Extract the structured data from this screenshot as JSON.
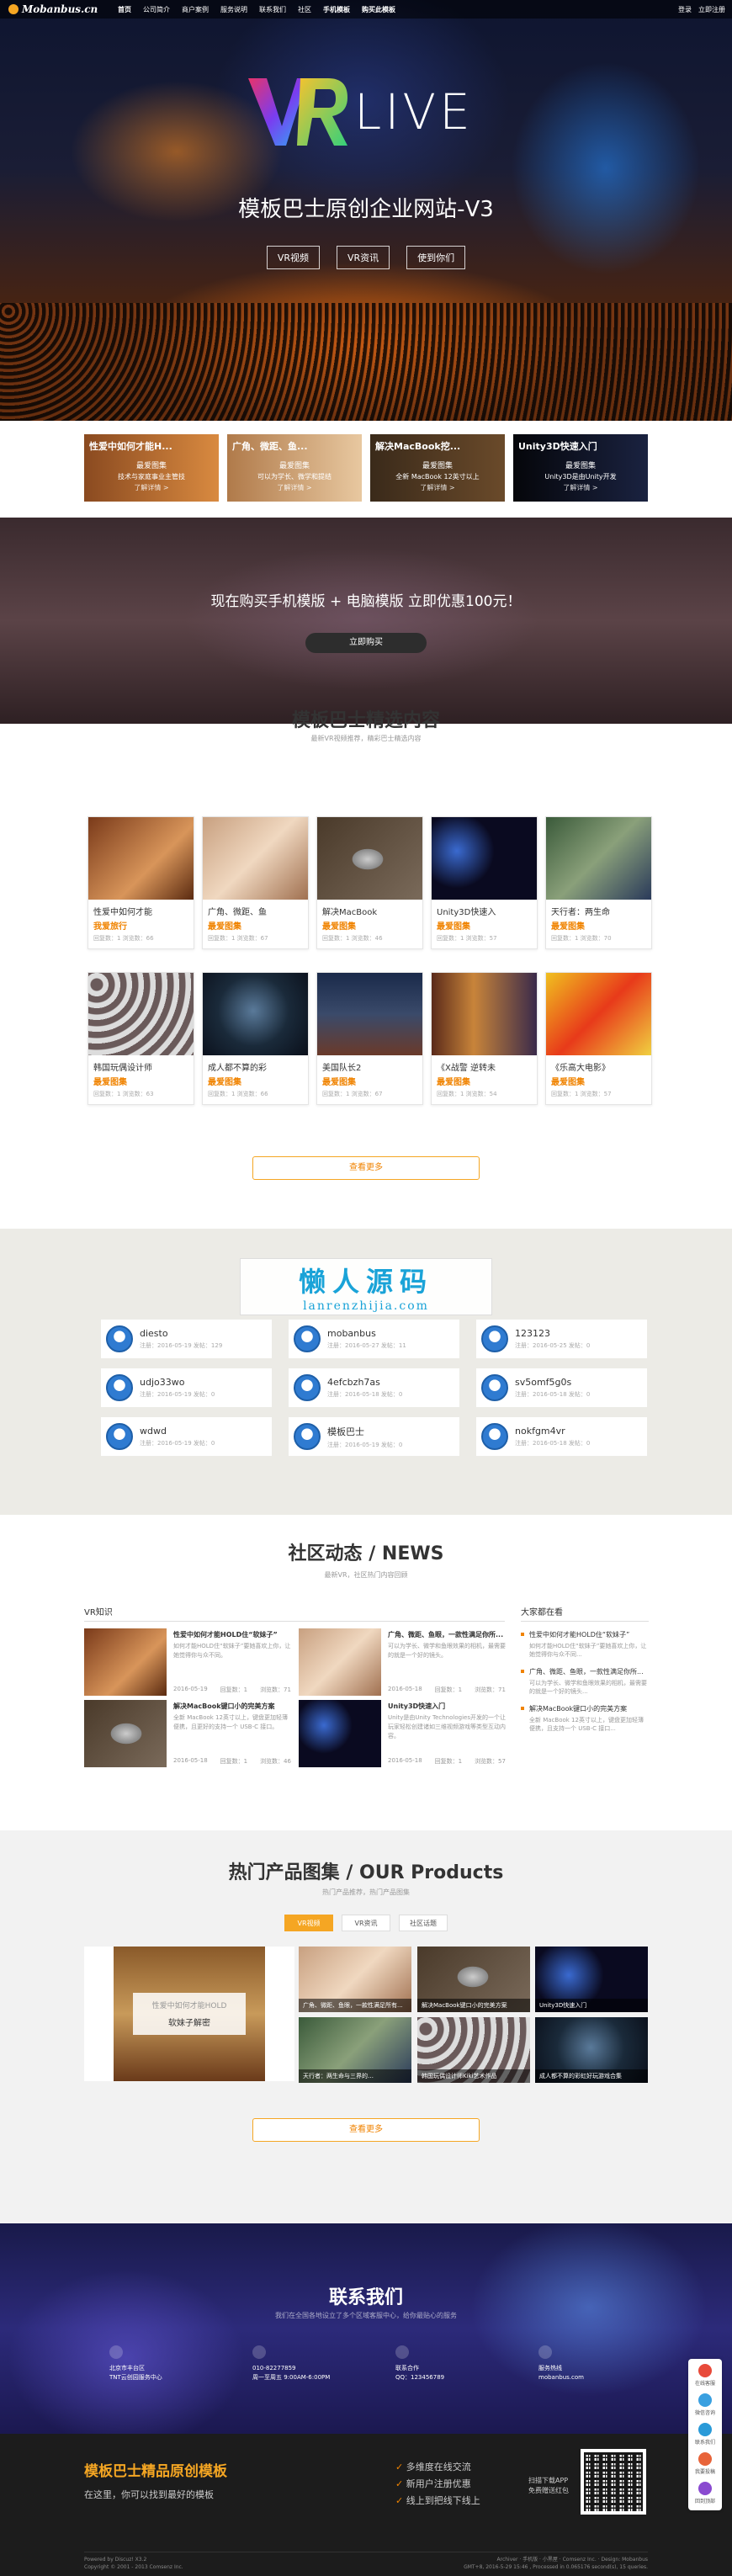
{
  "nav": {
    "logo": "Mobanbus.cn",
    "links": [
      "首页",
      "公司简介",
      "商户案例",
      "服务说明",
      "联系我们",
      "社区",
      "手机模板",
      "购买此模板"
    ],
    "right": [
      "登录",
      "立即注册"
    ]
  },
  "hero": {
    "logo_text": "LIVE",
    "title": "模板巴士原创企业网站-V3",
    "buttons": [
      "VR视频",
      "VR资讯",
      "使到你们"
    ]
  },
  "promos": [
    {
      "title": "性爱中如何才能H...",
      "sub": "最爱图集",
      "meta": "技术与家庭事业主管技",
      "link": "了解详情 >"
    },
    {
      "title": "广角、微距、鱼...",
      "sub": "最爱图集",
      "meta": "可以为学长、微学和提结",
      "link": "了解详情 >"
    },
    {
      "title": "解决MacBook挖...",
      "sub": "最爱图集",
      "meta": "全新 MacBook 12英寸以上",
      "link": "了解详情 >"
    },
    {
      "title": "Unity3D快速入门",
      "sub": "最爱图集",
      "meta": "Unity3D是由Unity开发",
      "link": "了解详情 >"
    }
  ],
  "banner2": {
    "title": "现在购买手机模版 + 电脑模版 立即优惠100元！",
    "button": "立即购买"
  },
  "featured": {
    "title": "模板巴士精选内容",
    "subtitle": "最新VR视频推荐，精彩巴士精选内容",
    "items": [
      {
        "title": "性爱中如何才能",
        "tag": "我爱旅行",
        "meta": "回复数：1   浏览数：66"
      },
      {
        "title": "广角、微距、鱼",
        "tag": "最爱图集",
        "meta": "回复数：1   浏览数：67"
      },
      {
        "title": "解决MacBook",
        "tag": "最爱图集",
        "meta": "回复数：1   浏览数：46"
      },
      {
        "title": "Unity3D快速入",
        "tag": "最爱图集",
        "meta": "回复数：1   浏览数：57"
      },
      {
        "title": "天行者：两生命",
        "tag": "最爱图集",
        "meta": "回复数：1   浏览数：70"
      },
      {
        "title": "韩国玩偶设计师",
        "tag": "最爱图集",
        "meta": "回复数：1   浏览数：63"
      },
      {
        "title": "成人都不算的彩",
        "tag": "最爱图集",
        "meta": "回复数：1   浏览数：66"
      },
      {
        "title": "美国队长2",
        "tag": "最爱图集",
        "meta": "回复数：1   浏览数：67"
      },
      {
        "title": "《X战警 逆转未",
        "tag": "最爱图集",
        "meta": "回复数：1   浏览数：54"
      },
      {
        "title": "《乐高大电影》",
        "tag": "最爱图集",
        "meta": "回复数：1   浏览数：57"
      }
    ],
    "more": "查看更多"
  },
  "members": {
    "watermark1": "懒人源码",
    "watermark2": "lanrenzhijia.com",
    "list": [
      {
        "name": "diesto",
        "meta": "注册：2016-05-19  发帖：129"
      },
      {
        "name": "mobanbus",
        "meta": "注册：2016-05-27  发帖：11"
      },
      {
        "name": "123123",
        "meta": "注册：2016-05-25  发帖：0"
      },
      {
        "name": "udjo33wo",
        "meta": "注册：2016-05-19  发帖：0"
      },
      {
        "name": "4efcbzh7as",
        "meta": "注册：2016-05-18  发帖：0"
      },
      {
        "name": "sv5omf5g0s",
        "meta": "注册：2016-05-18  发帖：0"
      },
      {
        "name": "wdwd",
        "meta": "注册：2016-05-19  发帖：0"
      },
      {
        "name": "模板巴士",
        "meta": "注册：2016-05-19  发帖：0"
      },
      {
        "name": "nokfgm4vr",
        "meta": "注册：2016-05-18  发帖：0"
      }
    ]
  },
  "news": {
    "title": "社区动态 / NEWS",
    "subtitle": "最新VR，社区热门内容回顾",
    "category": "VR知识",
    "items": [
      {
        "title": "性爱中如何才能HOLD住“软妹子”",
        "desc": "如何才能HOLD住“软妹子”要她喜欢上你，让她觉得你与众不同。",
        "date": "2016-05-19",
        "replies": "回复数：1",
        "views": "浏览数：71"
      },
      {
        "title": "广角、微距、鱼眼，一款性满足你所...",
        "desc": "可以为学长、微学和鱼眼效果的相机，最需要的就是一个好的镜头。",
        "date": "2016-05-18",
        "replies": "回复数：1",
        "views": "浏览数：71"
      },
      {
        "title": "解决MacBook键口小的完美方案",
        "desc": "全新 MacBook 12英寸以上，键盘更加轻薄便携，且更好的支持一个 USB-C 接口。",
        "date": "2016-05-18",
        "replies": "回复数：1",
        "views": "浏览数：46"
      },
      {
        "title": "Unity3D快速入门",
        "desc": "Unity是由Unity Technologies开发的一个让玩家轻松创建诸如三维视频游戏等类型互动内容。",
        "date": "2016-05-18",
        "replies": "回复数：1",
        "views": "浏览数：57"
      }
    ],
    "side_title": "大家都在看",
    "side": [
      {
        "title": "性爱中如何才能HOLD住“软妹子”",
        "desc": "如何才能HOLD住“软妹子”要她喜欢上你，让她觉得你与众不同..."
      },
      {
        "title": "广角、微距、鱼眼，一款性满足你所...",
        "desc": "可以为学长、微学和鱼眼效果的相机，最需要的就是一个好的镜头..."
      },
      {
        "title": "解决MacBook键口小的完美方案",
        "desc": "全新 MacBook 12英寸以上，键盘更加轻薄便携，且支持一个 USB-C 接口..."
      }
    ]
  },
  "products": {
    "title": "热门产品图集 / OUR Products",
    "subtitle": "热门产品推荐，热门产品图集",
    "tabs": [
      "VR视频",
      "VR资讯",
      "社区话题"
    ],
    "big_overlay_a": "性爱中如何才能HOLD",
    "big_overlay_b": "软妹子解密",
    "items": [
      "广角、微距、鱼眼，一款性满足所有...",
      "解决MacBook键口小的完美方案",
      "Unity3D快速入门",
      "天行者：两生命与三界的…",
      "韩国玩偶设计师Kiki艺术作品",
      "成人都不算的彩虹好玩游戏合集"
    ],
    "more": "查看更多"
  },
  "contact": {
    "title": "联系我们",
    "subtitle": "我们在全国各地设立了多个区域客服中心，给你最贴心的服务",
    "cols": [
      {
        "a": "北京市丰台区",
        "b": "TNT云创园服务中心"
      },
      {
        "a": "010-82277859",
        "b": "周一至周五 9:00AM-6:00PM"
      },
      {
        "a": "联系合作",
        "b": "QQ：123456789"
      },
      {
        "a": "服务热线",
        "b": "mobanbus.com"
      }
    ]
  },
  "footer": {
    "title": "模板巴士精品原创模板",
    "sub": "在这里，你可以找到最好的模板",
    "features": [
      "多维度在线交流",
      "新用户注册优惠",
      "线上到把线下线上"
    ],
    "qr_text": [
      "扫描下载APP",
      "免费赠送红包"
    ],
    "copyright_left": "Powered by Discuz! X3.2\nCopyright © 2001 - 2013 Comsenz Inc.",
    "copyright_right": "Archiver · 手机版 · 小黑屋 · Comsenz Inc. · Design: Mobanbus\nGMT+8, 2016-5-29 15:46 , Processed in 0.065176 second(s), 15 queries."
  },
  "side_toolbar": [
    "在线客服",
    "微信咨询",
    "联系我们",
    "我要投稿",
    "回到顶部"
  ]
}
